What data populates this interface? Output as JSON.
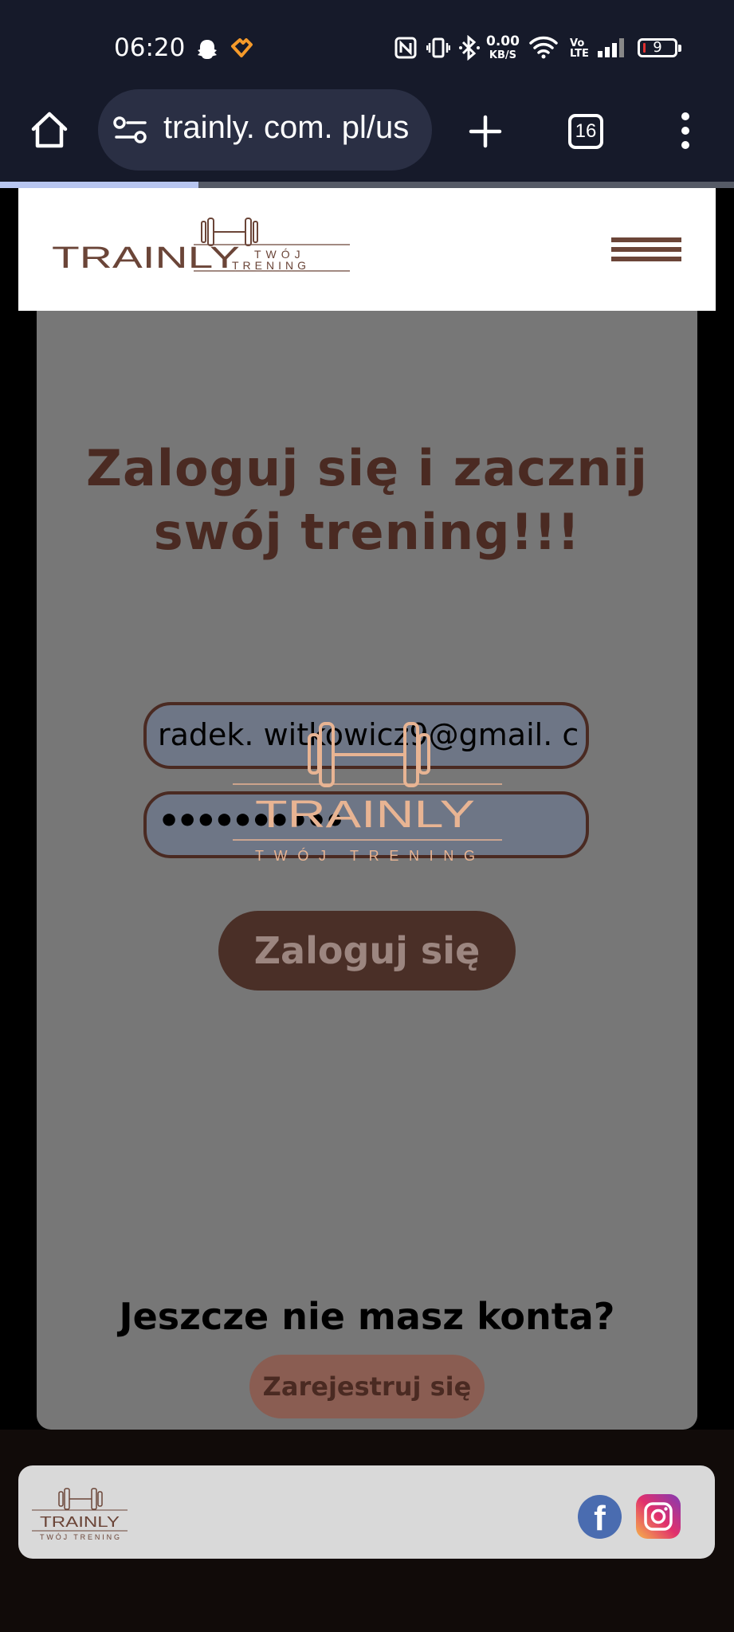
{
  "status_bar": {
    "time": "06:20",
    "network_speed_value": "0.00",
    "network_speed_unit": "KB/S",
    "volte_line1": "Vo",
    "volte_line2": "LTE",
    "battery": "9",
    "icons": [
      "snapchat-icon",
      "heart-app-icon",
      "nfc-icon",
      "vibrate-icon",
      "bluetooth-icon",
      "wifi-icon",
      "signal-icon",
      "battery-icon"
    ]
  },
  "browser": {
    "url": "trainly. com. pl/us",
    "tab_count": "16",
    "icons": [
      "home-icon",
      "site-settings-icon",
      "new-tab-icon",
      "tabs-icon",
      "more-menu-icon"
    ],
    "page_load_progress": 0.27
  },
  "header": {
    "logo_name": "TRAINLY",
    "logo_tagline_top": "TWÓJ",
    "logo_tagline_bottom": "TRENING"
  },
  "main": {
    "headline_line1": "Zaloguj się i zacznij",
    "headline_line2": "swój trening!!!",
    "email_value": "radek. witkowicz9@gmail. c",
    "password_mask": "••••••••••",
    "login_label": "Zaloguj się",
    "overlay_logo_name": "TRAINLY",
    "overlay_logo_tagline": "TWÓJ TRENING",
    "no_account_text": "Jeszcze nie masz konta?",
    "register_label": "Zarejestruj się"
  },
  "footer": {
    "logo_name": "TRAINLY",
    "logo_tagline": "TWÓJ TRENING",
    "social": [
      "facebook-icon",
      "instagram-icon"
    ]
  },
  "colors": {
    "brand_brown": "#4a2a22",
    "accent_peach": "#e8b493",
    "card_gray": "#777777",
    "browser_dark": "#161a2a"
  }
}
